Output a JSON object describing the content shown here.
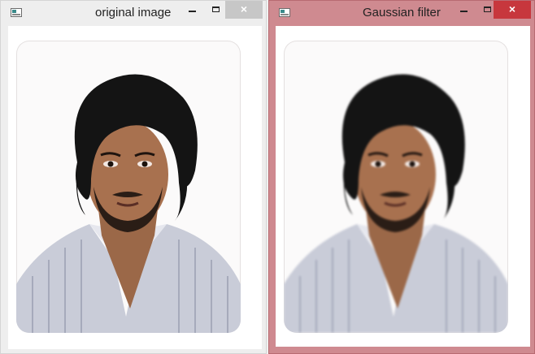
{
  "windows": {
    "left": {
      "title": "original image",
      "icon": "opencv-window-icon"
    },
    "right": {
      "title": "Gaussian filter",
      "icon": "opencv-window-icon"
    }
  },
  "controls": {
    "minimize": "minimize",
    "maximize": "maximize",
    "close": "×"
  },
  "colors": {
    "left_frame": "#eeeeee",
    "right_frame": "#cf8a90",
    "close_active": "#c7373d",
    "close_inactive": "#c7c7c7"
  }
}
